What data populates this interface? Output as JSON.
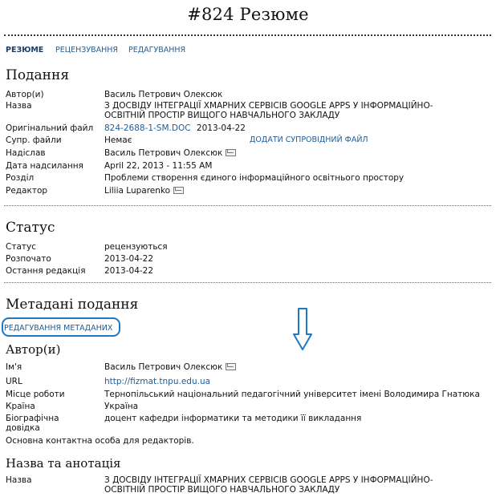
{
  "page_title": "#824 Резюме",
  "tabs": [
    "РЕЗЮМЕ",
    "РЕЦЕНЗУВАННЯ",
    "РЕДАГУВАННЯ"
  ],
  "submission": {
    "heading": "Подання",
    "rows": [
      {
        "label": "Автор(и)",
        "value": "Василь Петрович Олексюк"
      },
      {
        "label": "Назва",
        "value_line1": "З ДОСВІДУ ІНТЕГРАЦІЇ ХМАРНИХ СЕРВІСІВ GOOGLE APPS У ІНФОРМАЦІЙНО-",
        "value_line2": "ОСВІТНІЙ ПРОСТІР ВИЩОГО НАВЧАЛЬНОГО ЗАКЛАДУ"
      },
      {
        "label": "Оригінальний файл",
        "file_link": "824-2688-1-SM.DOC",
        "file_date": "2013-04-22"
      },
      {
        "label": "Супр. файли",
        "value": "Немає",
        "action": "ДОДАТИ СУПРОВІДНИЙ ФАЙЛ"
      },
      {
        "label": "Надіслав",
        "value": "Василь Петрович Олексюк"
      },
      {
        "label": "Дата надсилання",
        "value": "April 22, 2013 - 11:55 AM"
      },
      {
        "label": "Розділ",
        "value": "Проблеми створення єдиного інформаційного освітнього простору"
      },
      {
        "label": "Редактор",
        "value": "Liliia Luparenko"
      }
    ]
  },
  "status": {
    "heading": "Статус",
    "rows": [
      {
        "label": "Статус",
        "value": "рецензуються"
      },
      {
        "label": "Розпочато",
        "value": "2013-04-22"
      },
      {
        "label": "Остання редакція",
        "value": "2013-04-22"
      }
    ]
  },
  "metadata": {
    "heading": "Метадані подання",
    "edit_link": "РЕДАГУВАННЯ МЕТАДАНИХ",
    "authors_heading": "Автор(и)",
    "author_rows": [
      {
        "label": "Ім'я",
        "value": "Василь Петрович Олексюк"
      },
      {
        "label": "URL",
        "value": "http://fizmat.tnpu.edu.ua"
      },
      {
        "label": "Місце роботи",
        "value": "Тернопільський національний педагогічний університет імені Володимира Гнатюка"
      },
      {
        "label": "Країна",
        "value": "Україна"
      },
      {
        "label_line1": "Біографічна",
        "label_line2": "довідка",
        "value": "доцент кафедри інформатики та методики її викладання"
      }
    ],
    "contact_note": "Основна контактна особа для редакторів.",
    "title_abstract_heading": "Назва та анотація",
    "title_row": {
      "label": "Назва",
      "value_line1": "З ДОСВІДУ ІНТЕГРАЦІЇ ХМАРНИХ СЕРВІСІВ GOOGLE APPS У ІНФОРМАЦІЙНО-",
      "value_line2": "ОСВІТНІЙ ПРОСТІР ВИЩОГО НАВЧАЛЬНОГО ЗАКЛАДУ"
    }
  },
  "icons": {
    "email": "envelope-icon",
    "annotation_arrow": "down-arrow-icon"
  },
  "colors": {
    "link": "#1f5c99",
    "highlight": "#1e78c2"
  }
}
